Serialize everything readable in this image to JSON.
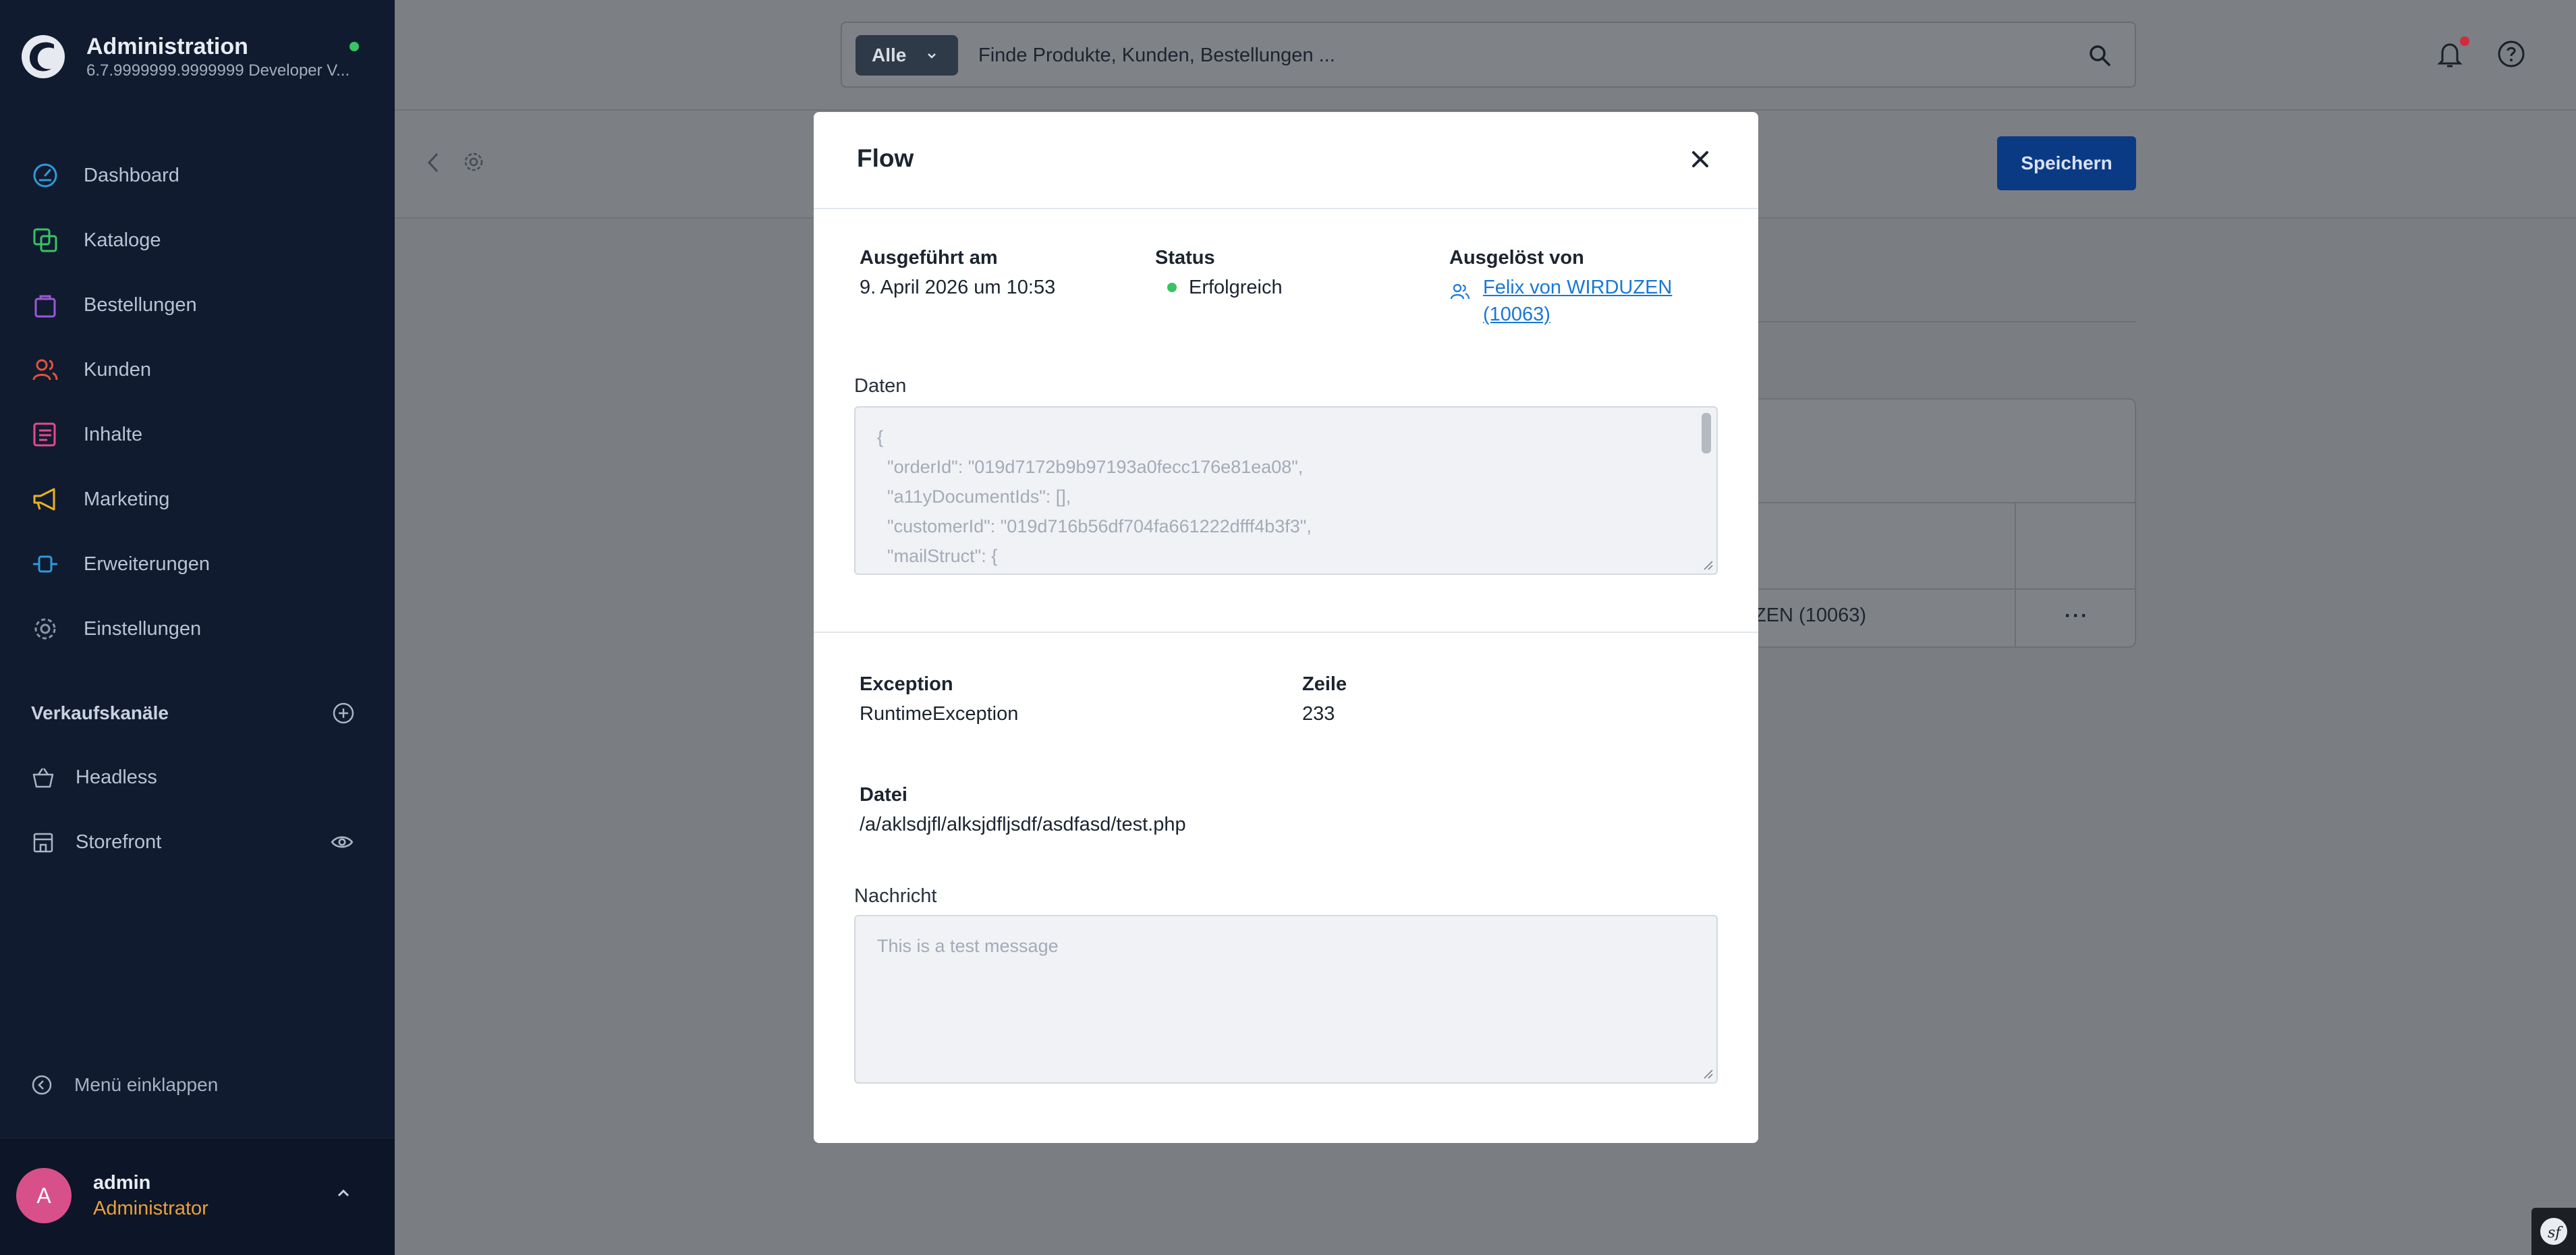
{
  "sidebar": {
    "app_title": "Administration",
    "app_version": "6.7.9999999.9999999 Developer V...",
    "nav": [
      {
        "label": "Dashboard",
        "icon": "gauge-icon",
        "color": "#2f9adb"
      },
      {
        "label": "Kataloge",
        "icon": "catalog-icon",
        "color": "#37c463"
      },
      {
        "label": "Bestellungen",
        "icon": "shopping-bag-icon",
        "color": "#9b59d6"
      },
      {
        "label": "Kunden",
        "icon": "customers-icon",
        "color": "#e5533a"
      },
      {
        "label": "Inhalte",
        "icon": "content-icon",
        "color": "#e34b92"
      },
      {
        "label": "Marketing",
        "icon": "megaphone-icon",
        "color": "#e8b31f"
      },
      {
        "label": "Erweiterungen",
        "icon": "plug-icon",
        "color": "#2f9adb"
      },
      {
        "label": "Einstellungen",
        "icon": "gear-icon",
        "color": "#8a94a6"
      }
    ],
    "sales_channels_title": "Verkaufskanäle",
    "sales_channels": [
      {
        "label": "Headless",
        "icon": "basket-icon"
      },
      {
        "label": "Storefront",
        "icon": "storefront-icon"
      }
    ],
    "collapse_label": "Menü einklappen",
    "user": {
      "initial": "A",
      "name": "admin",
      "role": "Administrator"
    }
  },
  "header": {
    "search_type": "Alle",
    "search_placeholder": "Finde Produkte, Kunden, Bestellungen ..."
  },
  "page": {
    "save_label": "Speichern",
    "bg_cell_text": "ZEN (10063)",
    "bg_row_actions": "···"
  },
  "modal": {
    "title": "Flow",
    "executed_label": "Ausgeführt am",
    "executed_value": "9. April 2026 um 10:53",
    "status_label": "Status",
    "status_value": "Erfolgreich",
    "triggered_label": "Ausgelöst von",
    "triggered_value_line1": "Felix von WIRDUZEN",
    "triggered_value_line2": "(10063)",
    "data_label": "Daten",
    "data_lines": [
      "{",
      "  \"orderId\": \"019d7172b9b97193a0fecc176e81ea08\",",
      "  \"a11yDocumentIds\": [],",
      "  \"customerId\": \"019d716b56df704fa661222dfff4b3f3\",",
      "  \"mailStruct\": {"
    ],
    "exception_label": "Exception",
    "exception_value": "RuntimeException",
    "line_label": "Zeile",
    "line_value": "233",
    "file_label": "Datei",
    "file_value": "/a/aklsdjfl/alksjdfljsdf/asdfasd/test.php",
    "message_label": "Nachricht",
    "message_value": "This is a test message"
  },
  "colors": {
    "sidebar_bg": "#111b30",
    "primary": "#0870ff",
    "link": "#1878d6",
    "success": "#37c463",
    "avatar": "#d8508a",
    "role": "#e7a13a"
  }
}
